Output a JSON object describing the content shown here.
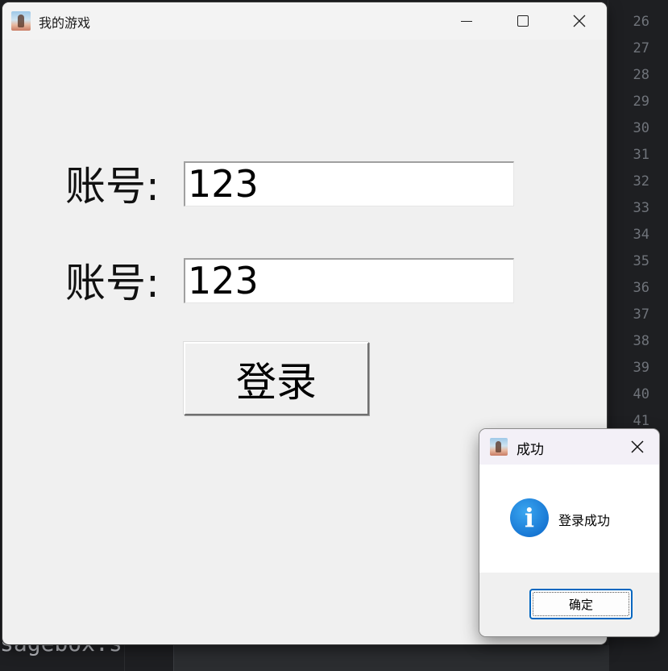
{
  "ide": {
    "line_numbers": [
      "26",
      "27",
      "28",
      "29",
      "30",
      "31",
      "32",
      "33",
      "34",
      "35",
      "36",
      "37",
      "38",
      "39",
      "40",
      "41"
    ],
    "bottom_text": "sagebox.s"
  },
  "main_window": {
    "title": "我的游戏",
    "fields": [
      {
        "label": "账号:",
        "value": "123"
      },
      {
        "label": "账号:",
        "value": "123"
      }
    ],
    "login_button": "登录"
  },
  "message_box": {
    "title": "成功",
    "icon": "info-icon",
    "message": "登录成功",
    "ok_button": "确定"
  },
  "colors": {
    "window_bg": "#f0f0f0",
    "info_blue": "#0a64c8",
    "focus_border": "#0067c0",
    "ide_bg": "#1e1f22"
  }
}
